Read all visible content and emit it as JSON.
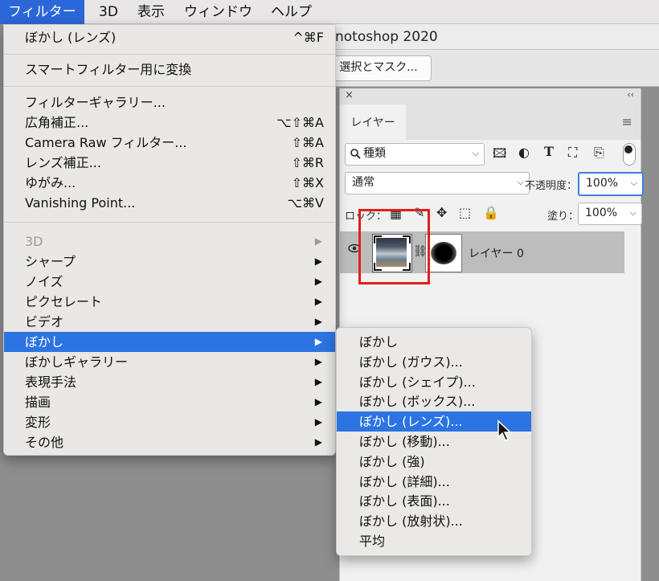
{
  "menubar": {
    "items": [
      "フィルター",
      "3D",
      "表示",
      "ウィンドウ",
      "ヘルプ"
    ]
  },
  "window": {
    "title": "notoshop 2020",
    "mask_button": "選択とマスク..."
  },
  "layers_panel": {
    "close": "×",
    "collapse": "‹‹",
    "tab": "レイヤー",
    "filter_kind": "種類",
    "blend_mode": "通常",
    "opacity_label": "不透明度：",
    "opacity_value": "100%",
    "lock_label": "ロック：",
    "fill_label": "塗り：",
    "fill_value": "100%",
    "layer_name": "レイヤー 0"
  },
  "filter_menu": {
    "last_filter": {
      "label": "ぼかし (レンズ)",
      "shortcut": "^⌘F"
    },
    "smart_filter": "スマートフィルター用に変換",
    "group2": [
      {
        "label": "フィルターギャラリー...",
        "shortcut": ""
      },
      {
        "label": "広角補正...",
        "shortcut": "⌥⇧⌘A"
      },
      {
        "label": "Camera Raw フィルター...",
        "shortcut": "⇧⌘A"
      },
      {
        "label": "レンズ補正...",
        "shortcut": "⇧⌘R"
      },
      {
        "label": "ゆがみ...",
        "shortcut": "⇧⌘X"
      },
      {
        "label": "Vanishing Point...",
        "shortcut": "⌥⌘V"
      }
    ],
    "submenus": [
      "3D",
      "シャープ",
      "ノイズ",
      "ピクセレート",
      "ビデオ",
      "ぼかし",
      "ぼかしギャラリー",
      "表現手法",
      "描画",
      "変形",
      "その他"
    ],
    "disabled_index": 0,
    "highlighted_index": 5
  },
  "blur_submenu": {
    "items": [
      "ぼかし",
      "ぼかし (ガウス)...",
      "ぼかし (シェイプ)...",
      "ぼかし (ボックス)...",
      "ぼかし (レンズ)...",
      "ぼかし (移動)...",
      "ぼかし (強)",
      "ぼかし (詳細)...",
      "ぼかし (表面)...",
      "ぼかし (放射状)...",
      "平均"
    ],
    "highlighted_index": 4
  },
  "colors": {
    "highlight": "#2c74e2",
    "menubar_active": "#2b67d8",
    "annotation_box": "#e21f1f"
  }
}
